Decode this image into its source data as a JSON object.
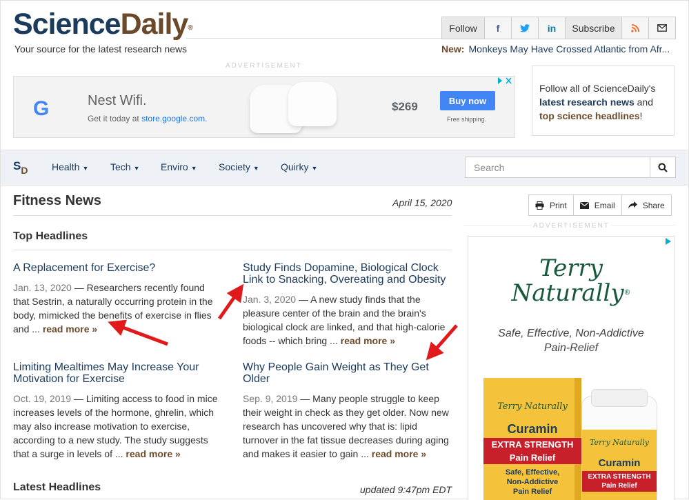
{
  "header": {
    "logo_main": "Science",
    "logo_accent": "Daily",
    "logo_mark": "®",
    "tagline": "Your source for the latest research news",
    "social": {
      "follow_label": "Follow",
      "facebook_glyph": "f",
      "twitter_glyph": "t",
      "linkedin_glyph": "in",
      "subscribe_label": "Subscribe"
    },
    "new_label": "New:",
    "new_text": "Monkeys May Have Crossed Atlantic from Afr..."
  },
  "ad_label": "ADVERTISEMENT",
  "top_ad": {
    "brand_glyph": "G",
    "title": "Nest Wifi.",
    "subtitle": "Get it today at",
    "store": "store.google.com.",
    "price": "$269",
    "button": "Buy now",
    "shipping": "Free shipping."
  },
  "follow_box": {
    "line1": "Follow all of ScienceDaily's",
    "link1": "latest research news",
    "and": "and",
    "link2": "top science headlines",
    "bang": "!"
  },
  "nav": {
    "logo_s": "S",
    "logo_d": "D",
    "items": [
      {
        "label": "Health"
      },
      {
        "label": "Tech"
      },
      {
        "label": "Enviro"
      },
      {
        "label": "Society"
      },
      {
        "label": "Quirky"
      }
    ],
    "search_placeholder": "Search"
  },
  "main": {
    "heading": "Fitness News",
    "date": "April 15, 2020",
    "top_headlines": "Top Headlines",
    "read_more": "read more »",
    "articles": [
      {
        "title": "A Replacement for Exercise?",
        "date": "Jan. 13, 2020",
        "text": " — Researchers recently found that Sestrin, a naturally occurring protein in the body, mimicked the benefits of exercise in flies and ... "
      },
      {
        "title": "Study Finds Dopamine, Biological Clock Link to Snacking, Overeating and Obesity",
        "date": "Jan. 3, 2020",
        "text": " — A new study finds that the pleasure center of the brain and the brain's biological clock are linked, and that high-calorie foods -- which bring ... "
      },
      {
        "title": "Limiting Mealtimes May Increase Your Motivation for Exercise",
        "date": "Oct. 19, 2019",
        "text": " — Limiting access to food in mice increases levels of the hormone, ghrelin, which may also increase motivation to exercise, according to a new study. The study suggests that a surge in levels of ... "
      },
      {
        "title": "Why People Gain Weight as They Get Older",
        "date": "Sep. 9, 2019",
        "text": " — Many people struggle to keep their weight in check as they get older. Now new research has uncovered why that is: lipid turnover in the fat tissue decreases during aging and makes it easier to gain ... "
      }
    ],
    "latest_headlines": "Latest Headlines",
    "updated": "updated 9:47pm EDT"
  },
  "share": {
    "print": "Print",
    "email": "Email",
    "share": "Share"
  },
  "side_ad": {
    "brand_line1": "Terry",
    "brand_line2": "Naturally",
    "brand_mark": "®",
    "tagline_line1": "Safe, Effective, Non-Addictive",
    "tagline_line2": "Pain-Relief",
    "product_brand": "Terry Naturally",
    "product_name": "Curamin",
    "product_strength": "EXTRA STRENGTH",
    "product_type": "Pain Relief",
    "product_desc_1": "Safe, Effective,",
    "product_desc_2": "Non-Addictive",
    "product_desc_3": "Pain Relief"
  },
  "colors": {
    "brand_blue": "#1b3a5c",
    "brand_brown": "#6b4a2b",
    "annotation_red": "#e0191b",
    "ad_button": "#4285f4"
  }
}
